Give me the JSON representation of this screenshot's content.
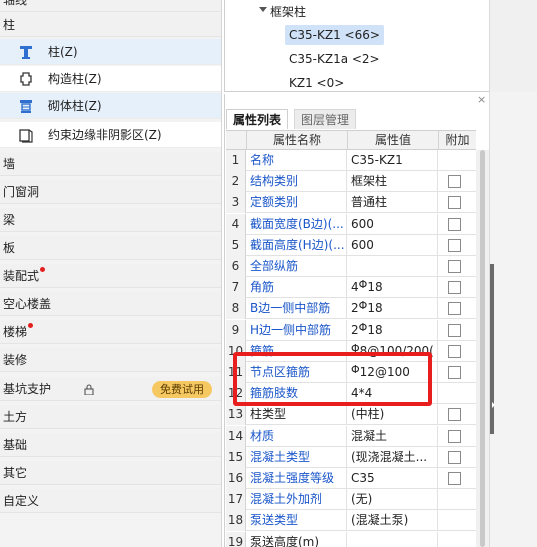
{
  "nav": {
    "top_partial": "轴线",
    "column_category": "柱",
    "column_items": [
      {
        "label": "柱(Z)",
        "icon": "column-icon",
        "selected": true
      },
      {
        "label": "构造柱(Z)",
        "icon": "construction-column-icon",
        "selected": false
      },
      {
        "label": "砌体柱(Z)",
        "icon": "masonry-column-icon",
        "selected": true
      },
      {
        "label": "约束边缘非阴影区(Z)",
        "icon": "boundary-zone-icon",
        "selected": false
      }
    ],
    "categories": [
      {
        "label": "墙",
        "dot": false
      },
      {
        "label": "门窗洞",
        "dot": false
      },
      {
        "label": "梁",
        "dot": false
      },
      {
        "label": "板",
        "dot": false
      },
      {
        "label": "装配式",
        "dot": true
      },
      {
        "label": "空心楼盖",
        "dot": false
      },
      {
        "label": "楼梯",
        "dot": true
      },
      {
        "label": "装修",
        "dot": false
      },
      {
        "label": "基坑支护",
        "dot": false
      },
      {
        "label": "土方",
        "dot": false
      },
      {
        "label": "基础",
        "dot": false
      },
      {
        "label": "其它",
        "dot": false
      },
      {
        "label": "自定义",
        "dot": false
      }
    ],
    "free_trial_badge": "免费试用",
    "dot_color": "#e32020"
  },
  "tree": {
    "parent": "框架柱",
    "children": [
      {
        "label": "C35-KZ1 <66>",
        "selected": true
      },
      {
        "label": "C35-KZ1a <2>",
        "selected": false
      },
      {
        "label": "KZ1 <0>",
        "selected": false
      }
    ]
  },
  "panel": {
    "close_glyph": "×",
    "tabs": [
      "属性列表",
      "图层管理"
    ],
    "columns": [
      "",
      "属性名称",
      "属性值",
      "附加"
    ]
  },
  "properties": [
    {
      "num": "1",
      "name": "名称",
      "value": "C35-KZ1",
      "link": true,
      "checkbox": false
    },
    {
      "num": "2",
      "name": "结构类别",
      "value": "框架柱",
      "link": true,
      "checkbox": true
    },
    {
      "num": "3",
      "name": "定额类别",
      "value": "普通柱",
      "link": true,
      "checkbox": true
    },
    {
      "num": "4",
      "name": "截面宽度(B边)(...",
      "value": "600",
      "link": true,
      "checkbox": true
    },
    {
      "num": "5",
      "name": "截面高度(H边)(...",
      "value": "600",
      "link": true,
      "checkbox": true
    },
    {
      "num": "6",
      "name": "全部纵筋",
      "value": "",
      "link": true,
      "checkbox": true
    },
    {
      "num": "7",
      "name": "角筋",
      "value_pre": "4",
      "rebar": "Φ",
      "value_post": "18",
      "link": true,
      "checkbox": true
    },
    {
      "num": "8",
      "name": "B边一侧中部筋",
      "value_pre": "2",
      "rebar": "Φ",
      "value_post": "18",
      "link": true,
      "checkbox": true
    },
    {
      "num": "9",
      "name": "H边一侧中部筋",
      "value_pre": "2",
      "rebar": "Φ",
      "value_post": "18",
      "link": true,
      "checkbox": true
    },
    {
      "num": "10",
      "name": "箍筋",
      "value_pre": "",
      "rebar": "Φ",
      "value_post": "8@100/200(",
      "link": true,
      "checkbox": true
    },
    {
      "num": "11",
      "name": "节点区箍筋",
      "value_pre": "",
      "rebar": "Φ",
      "value_post": "12@100",
      "link": true,
      "checkbox": true
    },
    {
      "num": "12",
      "name": "箍筋肢数",
      "value": "4*4",
      "link": true,
      "checkbox": false
    },
    {
      "num": "13",
      "name": "柱类型",
      "value": "(中柱)",
      "link": false,
      "checkbox": true
    },
    {
      "num": "14",
      "name": "材质",
      "value": "混凝土",
      "link": true,
      "checkbox": true
    },
    {
      "num": "15",
      "name": "混凝土类型",
      "value": "(现浇混凝土...",
      "link": true,
      "checkbox": true
    },
    {
      "num": "16",
      "name": "混凝土强度等级",
      "value": "C35",
      "link": true,
      "checkbox": true
    },
    {
      "num": "17",
      "name": "混凝土外加剂",
      "value": "(无)",
      "link": true,
      "checkbox": false
    },
    {
      "num": "18",
      "name": "泵送类型",
      "value": "(混凝土泵)",
      "link": true,
      "checkbox": false
    },
    {
      "num": "19",
      "name": "泵送高度(m)",
      "value": "",
      "link": false,
      "checkbox": false
    }
  ],
  "colors": {
    "accent_link": "#1a56c9",
    "highlight": "#e81e1e",
    "selection": "#cfe2f7"
  }
}
